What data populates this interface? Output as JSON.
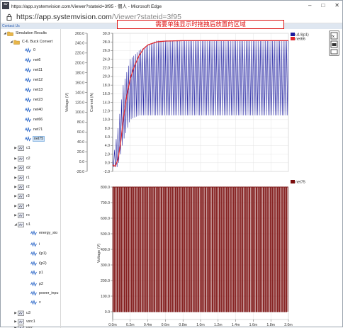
{
  "window": {
    "title": "https://app.systemvision.com/Viewer?stateid=3f95 - 個人 - Microsoft Edge",
    "badge": "SV",
    "url_host": "https://app.systemvision.com",
    "url_path": "/Viewer?stateid=3f95"
  },
  "contact_label": "Contact Us",
  "banner_text": "需要单独显示时拖拽后放置的区域",
  "tree": {
    "root": "Simulation Results",
    "project": "C-6. Buck Convert",
    "project_nets": [
      "0",
      "net6",
      "net11",
      "net12",
      "net13",
      "net23",
      "net40",
      "net66",
      "net71",
      "net75"
    ],
    "selected": "net75",
    "components_a": [
      "c1",
      "c2",
      "d2",
      "r1",
      "r2",
      "r3",
      "r4",
      "ro",
      "u1"
    ],
    "u1_children": [
      "energy_sto",
      "i",
      "i(p1)",
      "i(p2)",
      "p1",
      "p2",
      "power_inpu",
      "v"
    ],
    "components_b": [
      "u3",
      "vsrc1",
      "vsrc3",
      "vsrc..."
    ]
  },
  "colors": {
    "blue_series": "#1a1a9e",
    "red_series": "#e0282e",
    "darkred_series": "#7a0d0d",
    "banner_border": "#dd1111",
    "selection": "#cfe3f7"
  },
  "chart_data": [
    {
      "type": "line",
      "left_ylabel": "Voltage (V)",
      "left_ylim": [
        -20,
        260
      ],
      "left_ticks": [
        "-20.0",
        "0.0",
        "20.0",
        "40.0",
        "60.0",
        "80.0",
        "100.0",
        "120.0",
        "140.0",
        "160.0",
        "180.0",
        "200.0",
        "220.0",
        "240.0",
        "260.0"
      ],
      "right_ylabel": "Current (A)",
      "right_ylim": [
        -2,
        30
      ],
      "right_ticks": [
        "-2.0",
        "0.0",
        "2.0",
        "4.0",
        "6.0",
        "8.0",
        "10.0",
        "12.0",
        "14.0",
        "16.0",
        "18.0",
        "20.0",
        "22.0",
        "24.0",
        "26.0",
        "28.0",
        "30.0"
      ],
      "xlim": [
        0,
        2.0
      ],
      "xunit": "ms",
      "grid": true,
      "legend_position": "top-right",
      "series": [
        {
          "name": "u1/i(p1)",
          "axis": "right",
          "kind": "ripple",
          "peak": [
            [
              0.0,
              0.5
            ],
            [
              0.06,
              8.0
            ],
            [
              0.12,
              18.0
            ],
            [
              0.2,
              24.0
            ],
            [
              0.3,
              26.0
            ],
            [
              0.5,
              28.3
            ],
            [
              2.0,
              28.3
            ]
          ],
          "trough": [
            [
              0.0,
              -1.0
            ],
            [
              0.06,
              -1.0
            ],
            [
              0.12,
              5.0
            ],
            [
              0.2,
              10.0
            ],
            [
              0.3,
              11.0
            ],
            [
              0.5,
              11.0
            ],
            [
              2.0,
              11.0
            ]
          ]
        },
        {
          "name": "net66",
          "axis": "right",
          "kind": "line",
          "points": [
            [
              0.0,
              -0.5
            ],
            [
              0.03,
              -0.8
            ],
            [
              0.06,
              0.8
            ],
            [
              0.09,
              4.5
            ],
            [
              0.12,
              10.0
            ],
            [
              0.16,
              15.5
            ],
            [
              0.2,
              19.5
            ],
            [
              0.25,
              22.5
            ],
            [
              0.3,
              24.8
            ],
            [
              0.35,
              26.4
            ],
            [
              0.4,
              27.3
            ],
            [
              0.5,
              28.0
            ],
            [
              0.6,
              28.2
            ],
            [
              0.8,
              28.3
            ],
            [
              2.0,
              28.3
            ]
          ]
        }
      ]
    },
    {
      "type": "line",
      "ylabel": "Voltage (V)",
      "ylim": [
        -50,
        800
      ],
      "ticks": [
        "0.0",
        "100.0",
        "200.0",
        "300.0",
        "400.0",
        "500.0",
        "600.0",
        "700.0",
        "800.0"
      ],
      "xlim": [
        0,
        2.0
      ],
      "x_ticks": [
        "0.0m",
        "0.2m",
        "0.4m",
        "0.6m",
        "0.8m",
        "1.0m",
        "1.2m",
        "1.4m",
        "1.6m",
        "1.8m",
        "2.0m"
      ],
      "grid": true,
      "legend_position": "top-right",
      "series": [
        {
          "name": "net75",
          "kind": "pulse",
          "high": 800,
          "low": 0,
          "pulses_per_ms": 50
        }
      ]
    }
  ]
}
